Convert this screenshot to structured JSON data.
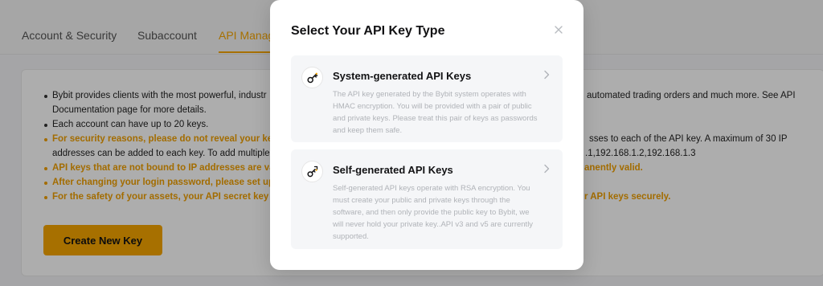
{
  "tabs": [
    {
      "label": "Account & Security"
    },
    {
      "label": "Subaccount"
    },
    {
      "label": "API Manag",
      "active": true
    }
  ],
  "notes": [
    {
      "text": "Bybit provides clients with the most powerful, industr",
      "warn": false
    },
    {
      "text": "Documentation page for more details.",
      "warn": false
    },
    {
      "text": "Each account can have up to 20 keys.",
      "warn": false
    },
    {
      "text": "For security reasons, please do not reveal your key(s",
      "warn": true
    },
    {
      "text": "addresses can be added to each key. To add multiple",
      "warn": false
    },
    {
      "text": "API keys that are not bound to IP addresses are vali",
      "warn": true
    },
    {
      "text": "After changing your login password, please set up n",
      "warn": true
    },
    {
      "text": "For the safety of your assets, your API secret key wi",
      "warn": true
    }
  ],
  "notes_right": [
    {
      "text": "automated trading orders and much more. See API",
      "warn": false
    },
    {
      "text": "sses to each of the API key. A maximum of 30 IP",
      "warn": false
    },
    {
      "text": ".1,192.168.1.2,192.168.1.3",
      "warn": false
    },
    {
      "text": "anently valid.",
      "warn": true
    },
    {
      "text": "r API keys securely.",
      "warn": true
    }
  ],
  "create_button": "Create New Key",
  "modal": {
    "title": "Select Your API Key Type",
    "options": [
      {
        "icon": "key-icon",
        "title": "System-generated API Keys",
        "description": "The API key generated by the Bybit system operates with HMAC encryption. You will be provided with a pair of public and private keys. Please treat this pair of keys as passwords and keep them safe."
      },
      {
        "icon": "self-key-icon",
        "title": "Self-generated API Keys",
        "description": "Self-generated API keys operate with RSA encryption. You must create your public and private keys through the software, and then only provide the public key to Bybit, we will never hold your private key..API v3 and v5 are currently supported."
      }
    ]
  },
  "colors": {
    "accent": "#f7a600",
    "warning_text": "#f0a000",
    "muted_text": "#b0b3b8"
  }
}
